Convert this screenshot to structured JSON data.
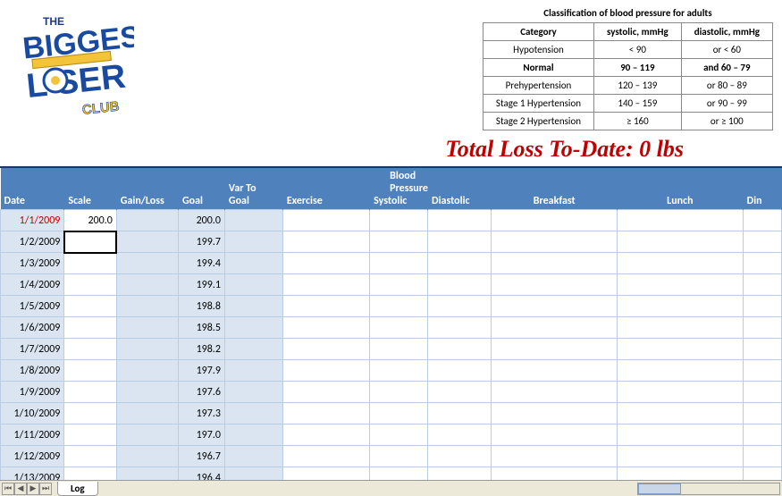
{
  "bp_classification": {
    "title": "Classification of blood pressure for adults",
    "headers": {
      "cat": "Category",
      "sys": "systolic, mmHg",
      "dia": "diastolic, mmHg"
    },
    "rows": [
      {
        "cat": "Hypotension",
        "sys": "< 90",
        "dia": "or < 60",
        "bold": false
      },
      {
        "cat": "Normal",
        "sys": "90 – 119",
        "dia": "and 60 – 79",
        "bold": true
      },
      {
        "cat": "Prehypertension",
        "sys": "120 – 139",
        "dia": "or 80 – 89",
        "bold": false
      },
      {
        "cat": "Stage 1 Hypertension",
        "sys": "140 – 159",
        "dia": "or 90 – 99",
        "bold": false
      },
      {
        "cat": "Stage 2 Hypertension",
        "sys": "≥ 160",
        "dia": "or ≥ 100",
        "bold": false
      }
    ]
  },
  "total_loss_label": "Total Loss To-Date: 0 lbs",
  "grid": {
    "headers": {
      "date": "Date",
      "scale": "Scale",
      "gainloss": "Gain/Loss",
      "goal": "Goal",
      "var": "Var To Goal",
      "exercise": "Exercise",
      "bp_group": "Blood Pressure",
      "systolic": "Systolic",
      "diastolic": "Diastolic",
      "breakfast": "Breakfast",
      "lunch": "Lunch",
      "dinner": "Din"
    },
    "rows": [
      {
        "date": "1/1/2009",
        "scale": "200.0",
        "goal": "200.0",
        "red": true
      },
      {
        "date": "1/2/2009",
        "scale": "",
        "goal": "199.7",
        "active": true
      },
      {
        "date": "1/3/2009",
        "scale": "",
        "goal": "199.4"
      },
      {
        "date": "1/4/2009",
        "scale": "",
        "goal": "199.1"
      },
      {
        "date": "1/5/2009",
        "scale": "",
        "goal": "198.8"
      },
      {
        "date": "1/6/2009",
        "scale": "",
        "goal": "198.5"
      },
      {
        "date": "1/7/2009",
        "scale": "",
        "goal": "198.2"
      },
      {
        "date": "1/8/2009",
        "scale": "",
        "goal": "197.9"
      },
      {
        "date": "1/9/2009",
        "scale": "",
        "goal": "197.6"
      },
      {
        "date": "1/10/2009",
        "scale": "",
        "goal": "197.3"
      },
      {
        "date": "1/11/2009",
        "scale": "",
        "goal": "197.0"
      },
      {
        "date": "1/12/2009",
        "scale": "",
        "goal": "196.7"
      },
      {
        "date": "1/13/2009",
        "scale": "",
        "goal": "196.4"
      }
    ]
  },
  "tab": {
    "name": "Log"
  }
}
